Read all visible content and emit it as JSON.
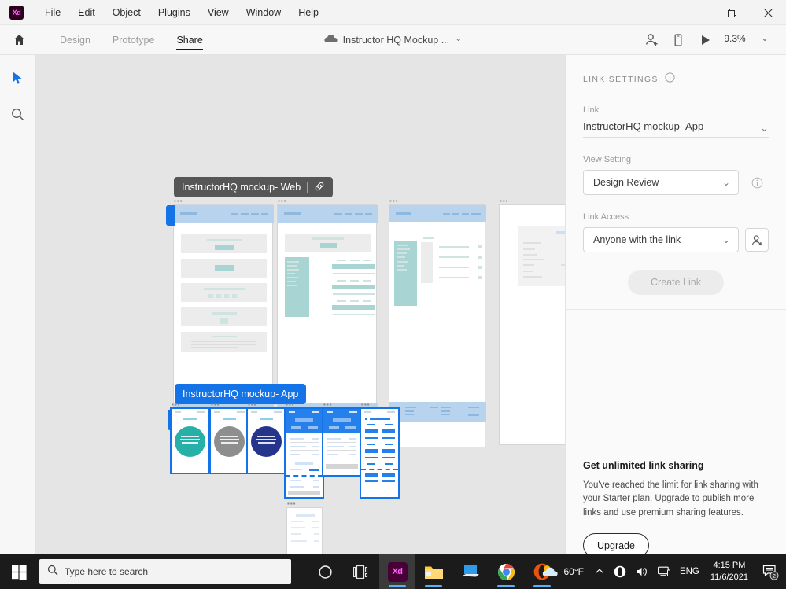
{
  "window": {
    "app_logo": "Xd",
    "menus": [
      "File",
      "Edit",
      "Object",
      "Plugins",
      "View",
      "Window",
      "Help"
    ],
    "controls": {
      "minimize": "–",
      "maximize": "❐",
      "close": "✕"
    }
  },
  "toolbar": {
    "home_icon": "home-icon",
    "tabs": [
      {
        "label": "Design",
        "active": false
      },
      {
        "label": "Prototype",
        "active": false
      },
      {
        "label": "Share",
        "active": true
      }
    ],
    "document_title": "Instructor HQ Mockup ...",
    "document_caret": "⌄",
    "cloud_icon": "cloud-icon",
    "coedit_icon": "invite-coeditor-icon",
    "device_icon": "device-preview-icon",
    "play_icon": "desktop-preview-icon",
    "zoom_level": "9.3%",
    "zoom_caret": "⌄"
  },
  "rail": {
    "select_tool": "select-tool",
    "zoom_tool": "zoom-tool"
  },
  "canvas": {
    "background_color": "#e5e5e5",
    "flags": [
      {
        "id": "web",
        "label": "InstructorHQ mockup- Web",
        "color": "#565656",
        "has_link_icon": true
      },
      {
        "id": "app",
        "label": "InstructorHQ mockup- App",
        "color": "#1473e6",
        "has_link_icon": false
      }
    ],
    "artboard_menu_dots": "▪▪▪",
    "web_artboards": 4,
    "app_artboards": 6,
    "selection_color": "#1473e6"
  },
  "panel": {
    "title": "LINK SETTINGS",
    "info_icon": "info-icon",
    "link_label": "Link",
    "link_value": "InstructorHQ mockup- App",
    "link_caret": "⌄",
    "view_setting_label": "View Setting",
    "view_setting_value": "Design Review",
    "view_setting_caret": "⌄",
    "view_setting_info_icon": "info-icon",
    "link_access_label": "Link Access",
    "link_access_value": "Anyone with the link",
    "link_access_caret": "⌄",
    "invite_icon": "add-person-icon",
    "create_link_label": "Create Link",
    "upsell_title": "Get unlimited link sharing",
    "upsell_body": "You've reached the limit for link sharing with your Starter plan. Upgrade to publish more links and use premium sharing features.",
    "upgrade_label": "Upgrade",
    "accent_colors": [
      "#ff2bc2",
      "#f5453b",
      "#2b44b4",
      "#f5453b"
    ]
  },
  "taskbar": {
    "start_icon": "windows-start-icon",
    "search_icon": "search-icon",
    "search_placeholder": "Type here to search",
    "cortana_icon": "cortana-icon",
    "taskview_icon": "task-view-icon",
    "apps": [
      {
        "name": "adobe-xd-icon",
        "label": "Xd",
        "active": true,
        "running": true
      },
      {
        "name": "file-explorer-icon",
        "label": "",
        "active": false,
        "running": true
      },
      {
        "name": "remote-desktop-icon",
        "label": "",
        "active": false,
        "running": false
      },
      {
        "name": "google-chrome-icon",
        "label": "",
        "active": false,
        "running": true
      },
      {
        "name": "opera-icon",
        "label": "",
        "active": false,
        "running": true
      }
    ],
    "weather_icon": "weather-partly-cloudy-icon",
    "weather_temp": "60°F",
    "chevron_up_icon": "show-hidden-icons-icon",
    "tray_icons": [
      "opera-tray-icon",
      "volume-icon",
      "network-icon"
    ],
    "language": "ENG",
    "time": "4:15 PM",
    "date": "11/6/2021",
    "notifications_icon": "notifications-icon",
    "notifications_count": "2"
  }
}
